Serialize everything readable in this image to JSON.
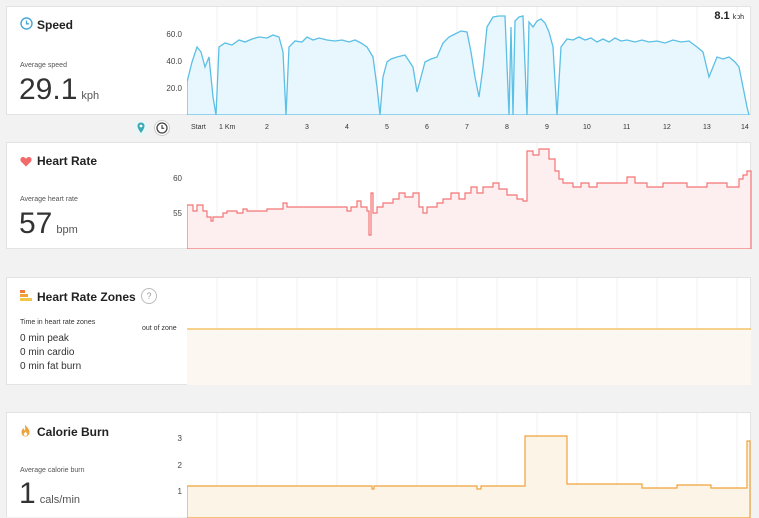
{
  "speed": {
    "title": "Speed",
    "avg_label": "Average speed",
    "avg_value": "29.1",
    "unit": "kph",
    "current_value": "8.1",
    "current_unit": "kph",
    "y_ticks": [
      "60.0",
      "40.0",
      "20.0"
    ],
    "color": "#5bbfe6",
    "fill": "#e8f7fd"
  },
  "distance_axis": {
    "labels": [
      "Start",
      "1 Km",
      "2",
      "3",
      "4",
      "5",
      "6",
      "7",
      "8",
      "9",
      "10",
      "11",
      "12",
      "13",
      "14"
    ]
  },
  "heart_rate": {
    "title": "Heart Rate",
    "avg_label": "Average heart rate",
    "avg_value": "57",
    "unit": "bpm",
    "y_ticks": [
      "60",
      "55"
    ],
    "color": "#f27575",
    "fill": "#fdefef"
  },
  "zones": {
    "title": "Heart Rate Zones",
    "help": "?",
    "label": "Time in heart rate zones",
    "peak": "0 min peak",
    "cardio": "0 min cardio",
    "fat_burn": "0 min fat burn",
    "line_label": "out of zone",
    "color": "#f2b84b",
    "fill": "#fdf7f1"
  },
  "calories": {
    "title": "Calorie Burn",
    "avg_label": "Average calorie burn",
    "avg_value": "1",
    "unit": "cals/min",
    "y_ticks": [
      "3",
      "2",
      "1"
    ],
    "color": "#f0a23a",
    "fill": "#fdf4e8"
  }
}
